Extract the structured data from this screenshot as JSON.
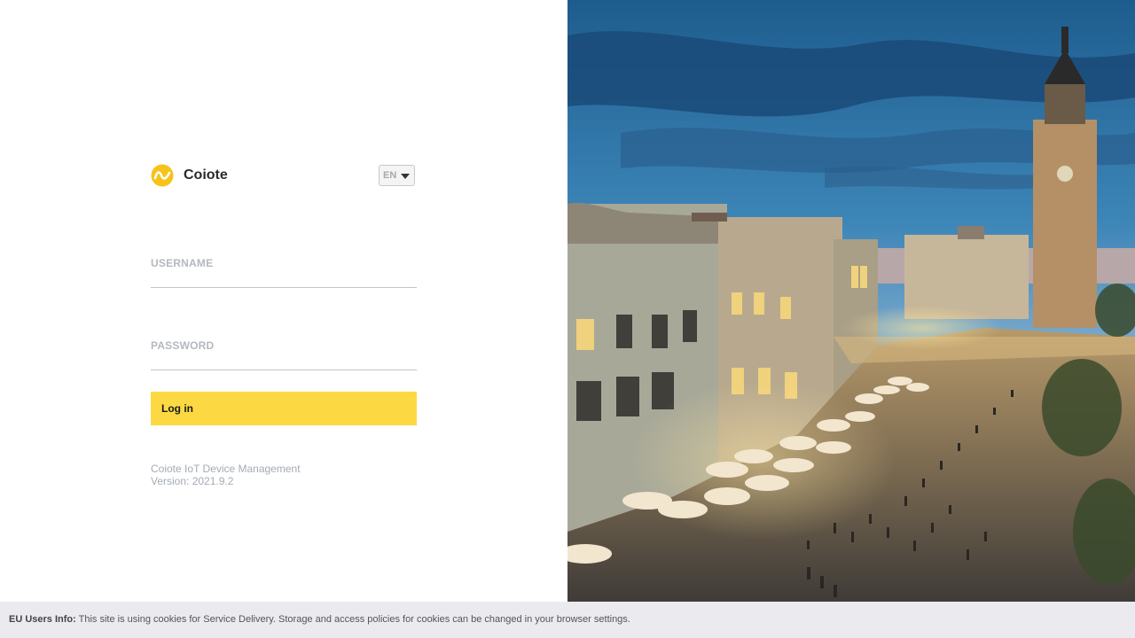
{
  "brand": {
    "name": "Coiote",
    "accent": "#f7c21a"
  },
  "language": {
    "selected": "EN"
  },
  "form": {
    "username_label": "USERNAME",
    "username_value": "",
    "password_label": "PASSWORD",
    "password_value": "",
    "login_label": "Log in"
  },
  "app_info": {
    "product": "Coiote IoT Device Management",
    "version": "Version: 2021.9.2"
  },
  "cookie_notice": {
    "title": "EU Users Info:",
    "text": "This site is using cookies for Service Delivery. Storage and access policies for cookies can be changed in your browser settings."
  },
  "colors": {
    "button": "#fcd942",
    "label": "#b4b8bf",
    "cookie_bar": "#ebeaee"
  }
}
